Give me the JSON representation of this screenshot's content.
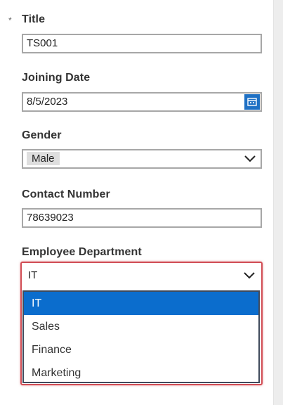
{
  "form": {
    "required_marker": "*",
    "title": {
      "label": "Title",
      "value": "TS001"
    },
    "joining_date": {
      "label": "Joining Date",
      "value": "8/5/2023",
      "picker_icon": "calendar-icon"
    },
    "gender": {
      "label": "Gender",
      "value": "Male",
      "dropdown_icon": "chevron-down-icon"
    },
    "contact_number": {
      "label": "Contact Number",
      "value": "78639023"
    },
    "employee_department": {
      "label": "Employee Department",
      "value": "IT",
      "dropdown_icon": "chevron-down-icon",
      "options": [
        "IT",
        "Sales",
        "Finance",
        "Marketing"
      ],
      "selected_index": 0
    }
  },
  "colors": {
    "selected_option_bg": "#0b6dcd",
    "calendar_button": "#1e70c4",
    "highlight_border": "#d14d55",
    "field_border": "#a7a7a7"
  }
}
